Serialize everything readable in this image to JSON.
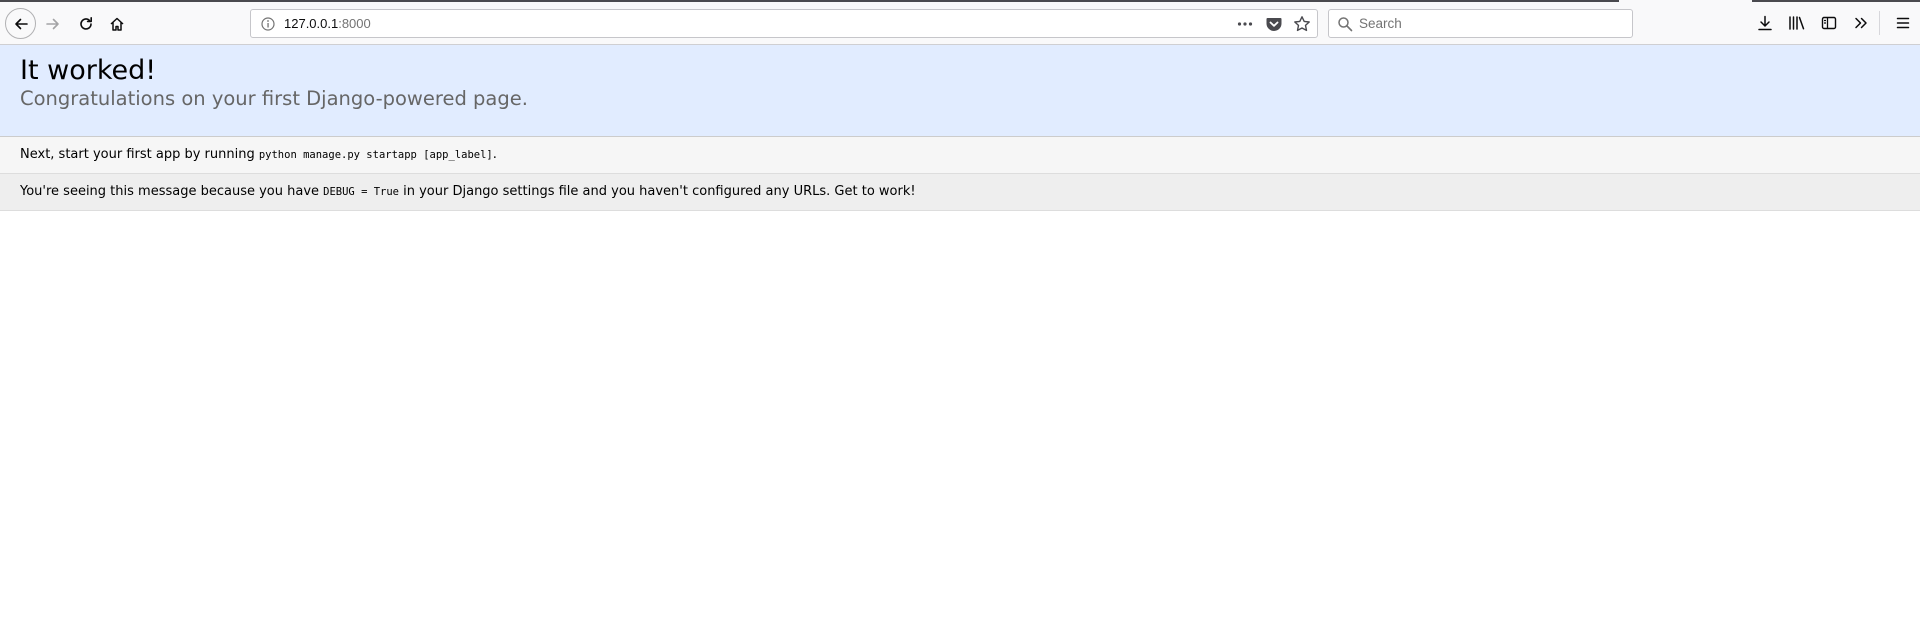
{
  "browser": {
    "url": {
      "host": "127.0.0.1",
      "port": ":8000"
    },
    "search": {
      "placeholder": "Search"
    },
    "icons": {
      "back": "back-arrow-icon",
      "forward": "forward-arrow-icon",
      "reload": "reload-icon",
      "home": "home-icon",
      "site_info": "info-icon",
      "page_actions": "more-dots-icon",
      "pocket": "pocket-icon",
      "bookmark": "star-icon",
      "search": "search-icon",
      "downloads": "download-icon",
      "library": "library-icon",
      "sidebar": "sidebar-icon",
      "overflow": "chevron-double-right-icon",
      "menu": "hamburger-menu-icon"
    }
  },
  "page": {
    "summary": {
      "title": "It worked!",
      "subtitle": "Congratulations on your first Django-powered page."
    },
    "instructions": {
      "text_before": "Next, start your first app by running ",
      "code": "python manage.py startapp [app_label]",
      "text_after": "."
    },
    "explanation": {
      "text_before": "You're seeing this message because you have ",
      "code": "DEBUG = True",
      "text_after": " in your Django settings file and you haven't configured any URLs. Get to work!"
    }
  },
  "colors": {
    "summary_background": "#e1ecff",
    "instructions_background": "#f6f6f6",
    "explanation_background": "#eeeeee",
    "subtitle_text": "#666666"
  }
}
